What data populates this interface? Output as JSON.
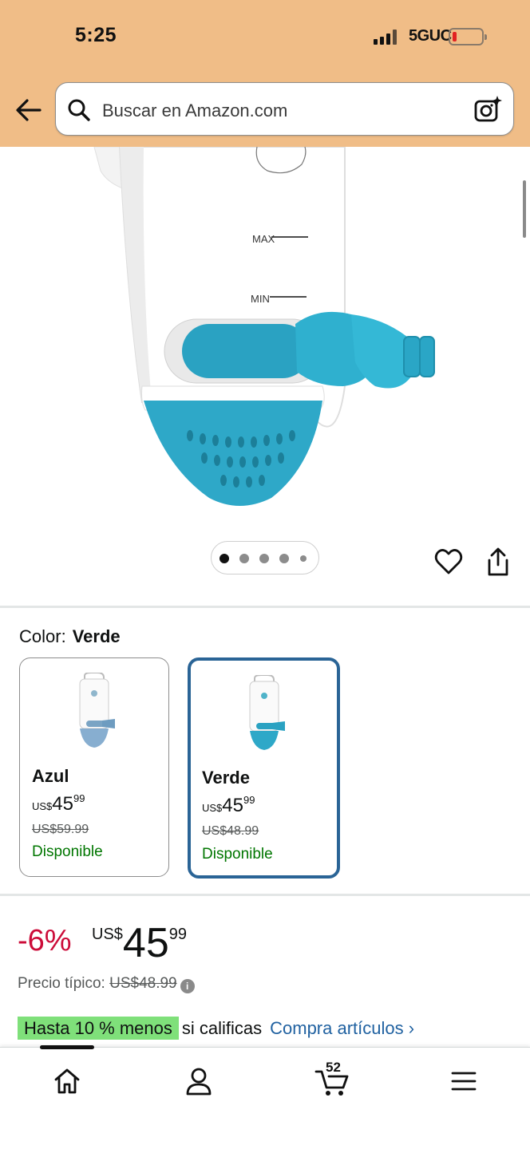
{
  "status_bar": {
    "time": "5:25",
    "network": "5GUC",
    "battery_color": "#e22222"
  },
  "header": {
    "back_icon": "arrow-left-icon",
    "search_placeholder": "Buscar en Amazon.com",
    "camera_icon": "camera-sparkle-icon",
    "bar_color": "#f0bd87"
  },
  "product_image": {
    "label_max": "MAX",
    "label_min": "MIN",
    "dots_count": 5,
    "active_dot": 0
  },
  "color_selector": {
    "label": "Color:",
    "selected": "Verde",
    "options": [
      {
        "name": "Azul",
        "currency": "US$",
        "whole": "45",
        "fraction": "99",
        "old_price": "US$59.99",
        "availability": "Disponible"
      },
      {
        "name": "Verde",
        "currency": "US$",
        "whole": "45",
        "fraction": "99",
        "old_price": "US$48.99",
        "availability": "Disponible"
      }
    ]
  },
  "pricing": {
    "discount": "-6%",
    "currency": "US$",
    "whole": "45",
    "fraction": "99",
    "typical_label": "Precio típico:",
    "typical_price": "US$48.99",
    "promo_highlight": "Hasta 10 % menos",
    "promo_text": "si calificas",
    "promo_link": "Compra artículos ›"
  },
  "bottom_nav": {
    "cart_count": "52",
    "items": [
      "home-icon",
      "account-icon",
      "cart-icon",
      "menu-icon"
    ]
  },
  "colors": {
    "accent_link": "#2162a1",
    "discount_red": "#cc0c39",
    "available_green": "#007600",
    "selected_border": "#2a6496",
    "highlight_green": "#7fe07a"
  }
}
